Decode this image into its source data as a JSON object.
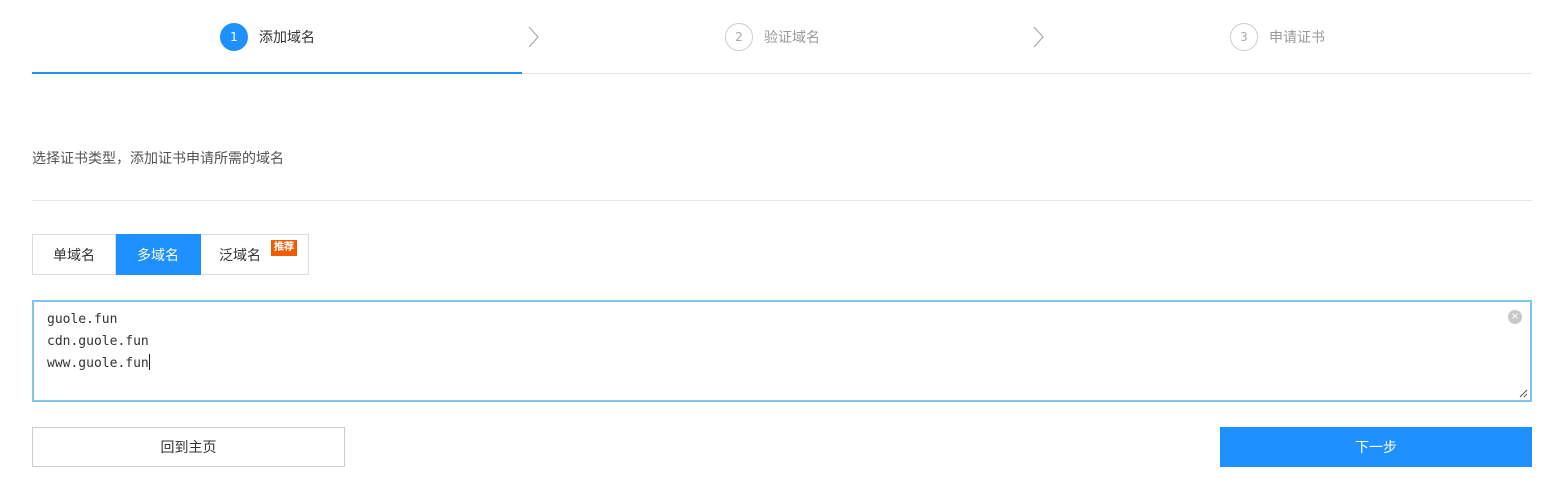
{
  "steps": [
    {
      "number": "1",
      "label": "添加域名",
      "active": true
    },
    {
      "number": "2",
      "label": "验证域名",
      "active": false
    },
    {
      "number": "3",
      "label": "申请证书",
      "active": false
    }
  ],
  "description": "选择证书类型，添加证书申请所需的域名",
  "tabs": [
    {
      "label": "单域名",
      "active": false
    },
    {
      "label": "多域名",
      "active": true
    },
    {
      "label": "泛域名",
      "active": false,
      "badge": "推荐"
    }
  ],
  "domains_input": {
    "lines": [
      "guole.fun",
      "cdn.guole.fun",
      "www.guole.fun"
    ]
  },
  "buttons": {
    "home": "回到主页",
    "next": "下一步"
  },
  "colors": {
    "accent": "#1e90ff",
    "badge": "#f25c05"
  },
  "icons": {
    "step_separator": "chevron-right-icon",
    "clear": "clear-icon",
    "resize": "resize-handle-icon"
  }
}
